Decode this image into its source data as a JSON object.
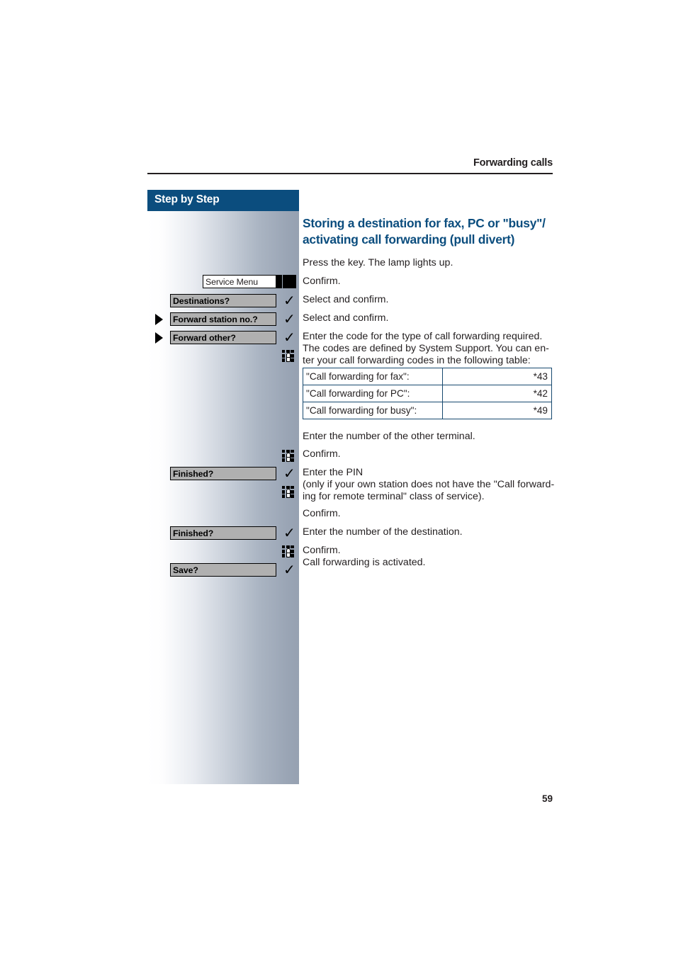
{
  "running_head": "Forwarding calls",
  "page_number": "59",
  "colors": {
    "accent_blue": "#0b4d7e",
    "table_border": "#17496f",
    "key_fill": "#b0b0b0",
    "text": "#231f20"
  },
  "sidebar": {
    "header_label": "Step by Step",
    "rows": [
      {
        "type": "input-key",
        "label": "Service Menu",
        "marker": "lamp",
        "has_arrow": false
      },
      {
        "type": "soft-key",
        "label": "Destinations?",
        "marker": "check",
        "has_arrow": false
      },
      {
        "type": "soft-key",
        "label": "Forward station no.?",
        "marker": "check",
        "has_arrow": true
      },
      {
        "type": "soft-key",
        "label": "Forward other?",
        "marker": "check",
        "has_arrow": true
      },
      {
        "type": "none",
        "label": "",
        "marker": "keypad",
        "has_arrow": false
      },
      {
        "type": "none",
        "label": "",
        "marker": "keypad",
        "has_arrow": false
      },
      {
        "type": "soft-key",
        "label": "Finished?",
        "marker": "check",
        "has_arrow": false
      },
      {
        "type": "none",
        "label": "",
        "marker": "keypad",
        "has_arrow": false
      },
      {
        "type": "soft-key",
        "label": "Finished?",
        "marker": "check",
        "has_arrow": false
      },
      {
        "type": "none",
        "label": "",
        "marker": "keypad",
        "has_arrow": false
      },
      {
        "type": "soft-key",
        "label": "Save?",
        "marker": "check",
        "has_arrow": false
      }
    ]
  },
  "content": {
    "title": "Storing a destination for fax, PC or \"busy\"/ activating call forwarding (pull divert)",
    "steps": [
      "Press the key. The lamp lights up.",
      "Confirm.",
      "Select and confirm.",
      "Select and confirm.",
      "Enter the code for the type of call forwarding required. The codes are defined by System Support. You can enter your call forwarding codes in the following table:",
      "Enter the number of the other terminal.",
      "Confirm.",
      "Enter the PIN (only if your own station does not have the \"Call forwarding for remote terminal\" class of service).",
      "Confirm.",
      "Enter the number of the destination.",
      "Confirm. Call forwarding is activated."
    ],
    "step_lines": {
      "press_key": "Press the key. The lamp lights up.",
      "confirm_1": "Confirm.",
      "select_confirm_1": "Select and confirm.",
      "select_confirm_2": "Select and confirm.",
      "enter_code_l1": "Enter the code for the type of call forwarding required.",
      "enter_code_l2": "The codes are defined by System Support. You can en-",
      "enter_code_l3": "ter your call forwarding codes in the following table:",
      "enter_other_number": "Enter the number of the other terminal.",
      "confirm_2": "Confirm.",
      "enter_pin_l1": "Enter the PIN",
      "enter_pin_l2": "(only if your own station does not have the \"Call forward-",
      "enter_pin_l3": "ing for remote terminal\" class of service).",
      "confirm_3": "Confirm.",
      "enter_destination": "Enter the number of the destination.",
      "confirm_4_l1": "Confirm.",
      "confirm_4_l2": "Call forwarding is activated."
    },
    "table": {
      "rows": [
        {
          "label": "\"Call forwarding for fax\":",
          "code": "*43"
        },
        {
          "label": "\"Call forwarding for PC\":",
          "code": "*42"
        },
        {
          "label": "\"Call forwarding for busy\":",
          "code": "*49"
        }
      ]
    }
  }
}
